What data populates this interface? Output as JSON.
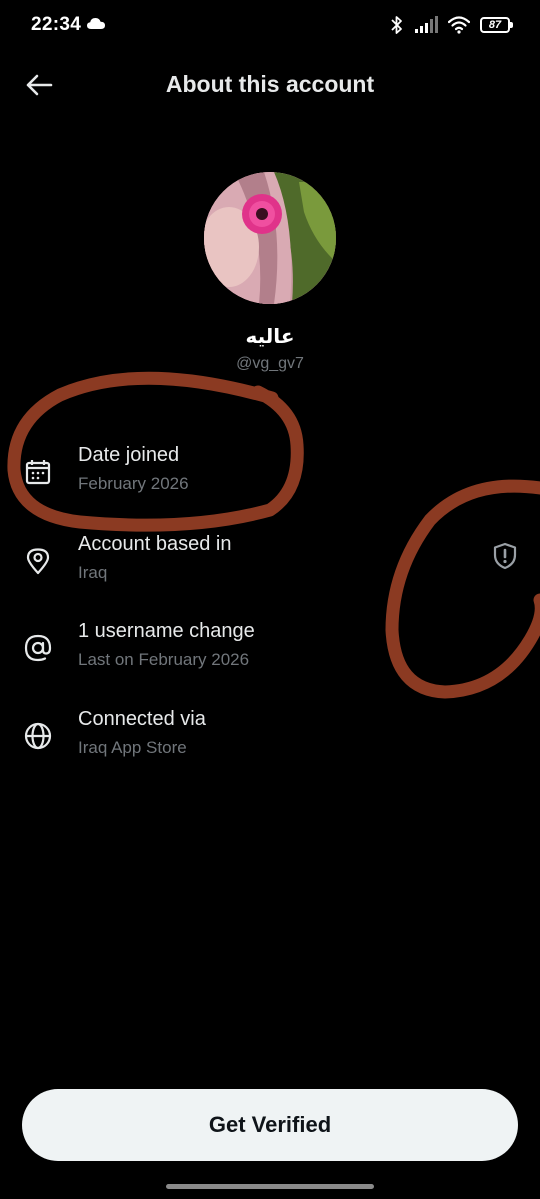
{
  "status_bar": {
    "time": "22:34",
    "battery": "87"
  },
  "header": {
    "title": "About this account"
  },
  "profile": {
    "display_name": "عاليه",
    "handle": "@vg_gv7"
  },
  "info_items": [
    {
      "label": "Date joined",
      "value": "February 2026",
      "icon": "calendar-icon"
    },
    {
      "label": "Account based in",
      "value": "Iraq",
      "icon": "location-pin-icon"
    },
    {
      "label": "1 username change",
      "value": "Last on February 2026",
      "icon": "at-sign-icon"
    },
    {
      "label": "Connected via",
      "value": "Iraq App Store",
      "icon": "globe-icon"
    }
  ],
  "footer": {
    "verify_label": "Get Verified"
  },
  "colors": {
    "background": "#000000",
    "primary_text": "#e7e9ea",
    "secondary_text": "#71767b",
    "button_bg": "#eff3f4",
    "annotation": "#8b3a22"
  }
}
